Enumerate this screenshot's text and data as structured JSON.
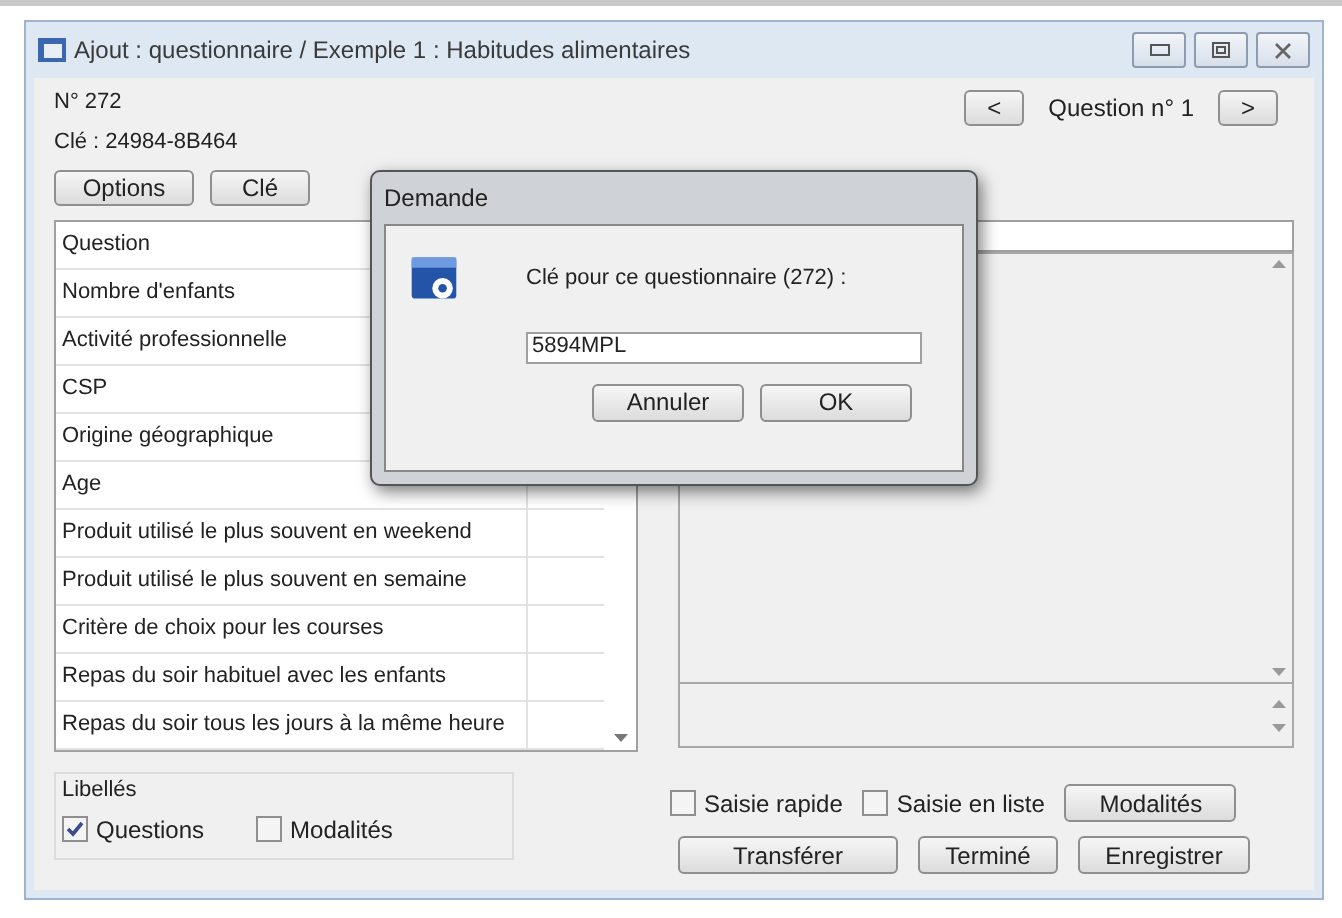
{
  "window": {
    "title": "Ajout : questionnaire / Exemple 1 : Habitudes alimentaires"
  },
  "record": {
    "number": "N° 272",
    "key": "Clé : 24984-8B464"
  },
  "top_buttons": [
    "Options",
    "Clé"
  ],
  "nav": {
    "prev": "<",
    "label": "Question n° 1",
    "next": ">"
  },
  "questions": [
    "Question",
    "Nombre d'enfants",
    "Activité professionnelle",
    "CSP",
    "Origine géographique",
    "Age",
    "Produit utilisé le plus souvent en weekend",
    "Produit utilisé le plus souvent en semaine",
    "Critère de choix pour les courses",
    "Repas du soir habituel avec les enfants",
    "Repas du soir tous les jours à la même heure"
  ],
  "labels_group": {
    "title": "Libellés",
    "options": [
      {
        "label": "Questions",
        "checked": true
      },
      {
        "label": "Modalités",
        "checked": false
      }
    ]
  },
  "entry_options": [
    {
      "label": "Saisie rapide",
      "checked": false
    },
    {
      "label": "Saisie en liste",
      "checked": false
    }
  ],
  "modalities_button": "Modalités",
  "bottom_buttons": [
    "Transférer",
    "Terminé",
    "Enregistrer"
  ],
  "dialog": {
    "title": "Demande",
    "prompt": "Clé pour ce questionnaire (272) :",
    "value": "5894MPL",
    "buttons": [
      "Annuler",
      "OK"
    ]
  }
}
